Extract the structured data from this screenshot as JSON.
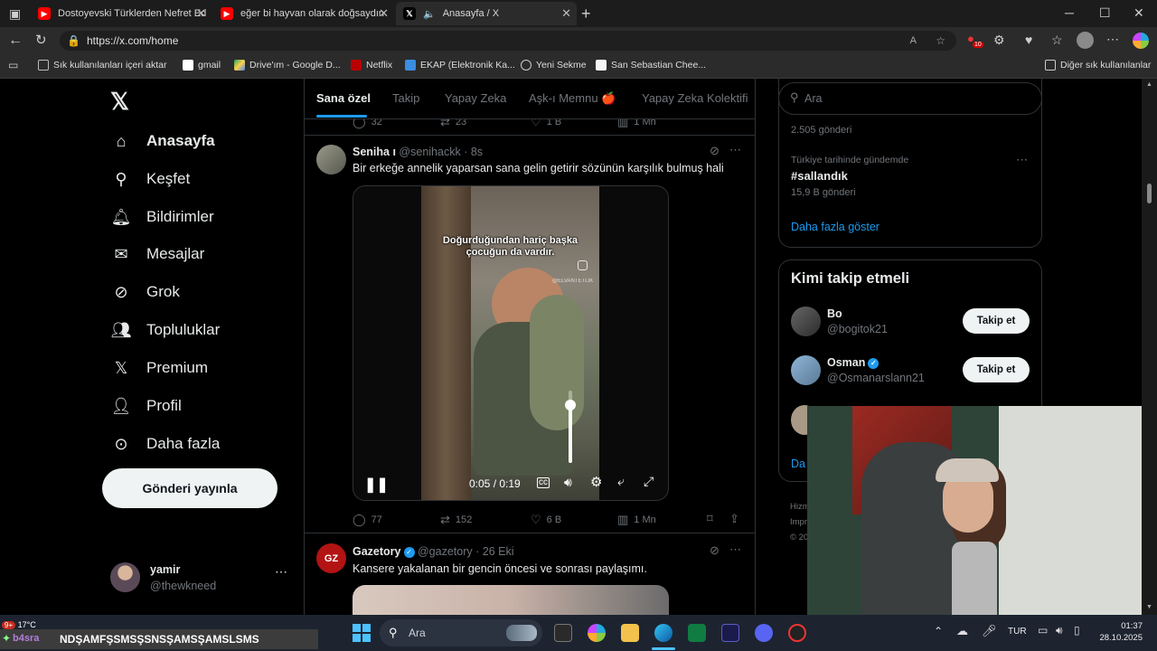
{
  "tabs": [
    {
      "title": "Dostoyevski Türklerden Nefret Ed",
      "color": "#ff0000"
    },
    {
      "title": "eğer bi hayvan olarak doğsaydın",
      "color": "#ff0000"
    },
    {
      "title": "Anasayfa / X",
      "color": "#000000"
    }
  ],
  "address": {
    "url": "https://x.com/home",
    "extension_badge": "10"
  },
  "bookmarks": [
    {
      "label": "Sık kullanılanları içeri aktar"
    },
    {
      "label": "gmail"
    },
    {
      "label": "Drive'ım - Google D..."
    },
    {
      "label": "Netflix"
    },
    {
      "label": "EKAP (Elektronik Ka..."
    },
    {
      "label": "Yeni Sekme"
    },
    {
      "label": "San Sebastian Chee..."
    },
    {
      "label": "Diğer sık kullanılanlar"
    }
  ],
  "sidebar": {
    "items": [
      {
        "label": "Anasayfa",
        "icon": "home-icon"
      },
      {
        "label": "Keşfet",
        "icon": "search-icon"
      },
      {
        "label": "Bildirimler",
        "icon": "bell-icon"
      },
      {
        "label": "Mesajlar",
        "icon": "mail-icon"
      },
      {
        "label": "Grok",
        "icon": "grok-icon"
      },
      {
        "label": "Topluluklar",
        "icon": "people-icon"
      },
      {
        "label": "Premium",
        "icon": "x-icon"
      },
      {
        "label": "Profil",
        "icon": "person-icon"
      },
      {
        "label": "Daha fazla",
        "icon": "more-circle-icon"
      }
    ],
    "post_button": "Gönderi yayınla",
    "account": {
      "name": "yamir",
      "handle": "@thewkneed"
    }
  },
  "feed_tabs": [
    "Sana özel",
    "Takip",
    "Yapay Zeka",
    "Aşk-ı Memnu 🍎",
    "Yapay Zeka Kolektifi"
  ],
  "prev_tweet_actions": {
    "replies": "32",
    "retweets": "23",
    "likes": "1 B",
    "views": "1 Mn"
  },
  "tweet1": {
    "name": "Seniha ı",
    "handle": "@senihackk",
    "time": "8s",
    "text": "Bir erkeğe annelik yaparsan sana gelin getirir sözünün karşılık bulmuş hali",
    "video": {
      "caption_line1": "Doğurduğundan hariç başka",
      "caption_line2": "çocuğun da vardır.",
      "watermark": "@ELVANTETLIK",
      "time": "0:05 / 0:19",
      "volume": 0.8
    },
    "actions": {
      "replies": "77",
      "retweets": "152",
      "likes": "6 B",
      "views": "1 Mn"
    }
  },
  "tweet2": {
    "name": "Gazetory",
    "handle": "@gazetory",
    "time": "26 Eki",
    "text": "Kansere yakalanan bir gencin öncesi ve sonrası paylaşımı.",
    "avatar_text": "GZ"
  },
  "right": {
    "search_placeholder": "Ara",
    "trend_top_count": "2.505 gönderi",
    "trend_context": "Türkiye tarihinde gündemde",
    "trend_tag": "#sallandık",
    "trend_count": "15,9 B gönderi",
    "show_more": "Daha fazla göster",
    "who_to_follow_title": "Kimi takip etmeli",
    "follow_suggestions": [
      {
        "name": "Bo",
        "handle": "@bogitok21",
        "verified": false,
        "button": "Takip et"
      },
      {
        "name": "Osman",
        "handle": "@Osmanarslann21",
        "verified": true,
        "button": "Takip et"
      }
    ],
    "partial_show_more": "Da",
    "footer_partial": [
      "Hizm",
      "Impr",
      "© 20"
    ]
  },
  "taskbar": {
    "weather_temp": "17°C",
    "weather_badge": "9+",
    "ticker": "NDŞAMFŞSMSŞSNSŞAMSŞAMSLSMS",
    "ticker_prefix": "b4sra",
    "search_label": "Ara",
    "language": "TUR",
    "time": "01:37",
    "date": "28.10.2025"
  }
}
